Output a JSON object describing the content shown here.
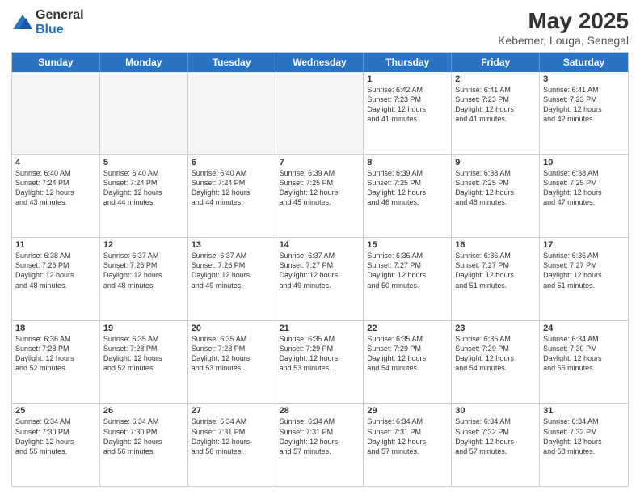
{
  "logo": {
    "general": "General",
    "blue": "Blue"
  },
  "title": {
    "month": "May 2025",
    "location": "Kebemer, Louga, Senegal"
  },
  "days": [
    "Sunday",
    "Monday",
    "Tuesday",
    "Wednesday",
    "Thursday",
    "Friday",
    "Saturday"
  ],
  "rows": [
    [
      {
        "day": "",
        "info": "",
        "empty": true
      },
      {
        "day": "",
        "info": "",
        "empty": true
      },
      {
        "day": "",
        "info": "",
        "empty": true
      },
      {
        "day": "",
        "info": "",
        "empty": true
      },
      {
        "day": "1",
        "info": "Sunrise: 6:42 AM\nSunset: 7:23 PM\nDaylight: 12 hours\nand 41 minutes."
      },
      {
        "day": "2",
        "info": "Sunrise: 6:41 AM\nSunset: 7:23 PM\nDaylight: 12 hours\nand 41 minutes."
      },
      {
        "day": "3",
        "info": "Sunrise: 6:41 AM\nSunset: 7:23 PM\nDaylight: 12 hours\nand 42 minutes."
      }
    ],
    [
      {
        "day": "4",
        "info": "Sunrise: 6:40 AM\nSunset: 7:24 PM\nDaylight: 12 hours\nand 43 minutes."
      },
      {
        "day": "5",
        "info": "Sunrise: 6:40 AM\nSunset: 7:24 PM\nDaylight: 12 hours\nand 44 minutes."
      },
      {
        "day": "6",
        "info": "Sunrise: 6:40 AM\nSunset: 7:24 PM\nDaylight: 12 hours\nand 44 minutes."
      },
      {
        "day": "7",
        "info": "Sunrise: 6:39 AM\nSunset: 7:25 PM\nDaylight: 12 hours\nand 45 minutes."
      },
      {
        "day": "8",
        "info": "Sunrise: 6:39 AM\nSunset: 7:25 PM\nDaylight: 12 hours\nand 46 minutes."
      },
      {
        "day": "9",
        "info": "Sunrise: 6:38 AM\nSunset: 7:25 PM\nDaylight: 12 hours\nand 46 minutes."
      },
      {
        "day": "10",
        "info": "Sunrise: 6:38 AM\nSunset: 7:25 PM\nDaylight: 12 hours\nand 47 minutes."
      }
    ],
    [
      {
        "day": "11",
        "info": "Sunrise: 6:38 AM\nSunset: 7:26 PM\nDaylight: 12 hours\nand 48 minutes."
      },
      {
        "day": "12",
        "info": "Sunrise: 6:37 AM\nSunset: 7:26 PM\nDaylight: 12 hours\nand 48 minutes."
      },
      {
        "day": "13",
        "info": "Sunrise: 6:37 AM\nSunset: 7:26 PM\nDaylight: 12 hours\nand 49 minutes."
      },
      {
        "day": "14",
        "info": "Sunrise: 6:37 AM\nSunset: 7:27 PM\nDaylight: 12 hours\nand 49 minutes."
      },
      {
        "day": "15",
        "info": "Sunrise: 6:36 AM\nSunset: 7:27 PM\nDaylight: 12 hours\nand 50 minutes."
      },
      {
        "day": "16",
        "info": "Sunrise: 6:36 AM\nSunset: 7:27 PM\nDaylight: 12 hours\nand 51 minutes."
      },
      {
        "day": "17",
        "info": "Sunrise: 6:36 AM\nSunset: 7:27 PM\nDaylight: 12 hours\nand 51 minutes."
      }
    ],
    [
      {
        "day": "18",
        "info": "Sunrise: 6:36 AM\nSunset: 7:28 PM\nDaylight: 12 hours\nand 52 minutes."
      },
      {
        "day": "19",
        "info": "Sunrise: 6:35 AM\nSunset: 7:28 PM\nDaylight: 12 hours\nand 52 minutes."
      },
      {
        "day": "20",
        "info": "Sunrise: 6:35 AM\nSunset: 7:28 PM\nDaylight: 12 hours\nand 53 minutes."
      },
      {
        "day": "21",
        "info": "Sunrise: 6:35 AM\nSunset: 7:29 PM\nDaylight: 12 hours\nand 53 minutes."
      },
      {
        "day": "22",
        "info": "Sunrise: 6:35 AM\nSunset: 7:29 PM\nDaylight: 12 hours\nand 54 minutes."
      },
      {
        "day": "23",
        "info": "Sunrise: 6:35 AM\nSunset: 7:29 PM\nDaylight: 12 hours\nand 54 minutes."
      },
      {
        "day": "24",
        "info": "Sunrise: 6:34 AM\nSunset: 7:30 PM\nDaylight: 12 hours\nand 55 minutes."
      }
    ],
    [
      {
        "day": "25",
        "info": "Sunrise: 6:34 AM\nSunset: 7:30 PM\nDaylight: 12 hours\nand 55 minutes."
      },
      {
        "day": "26",
        "info": "Sunrise: 6:34 AM\nSunset: 7:30 PM\nDaylight: 12 hours\nand 56 minutes."
      },
      {
        "day": "27",
        "info": "Sunrise: 6:34 AM\nSunset: 7:31 PM\nDaylight: 12 hours\nand 56 minutes."
      },
      {
        "day": "28",
        "info": "Sunrise: 6:34 AM\nSunset: 7:31 PM\nDaylight: 12 hours\nand 57 minutes."
      },
      {
        "day": "29",
        "info": "Sunrise: 6:34 AM\nSunset: 7:31 PM\nDaylight: 12 hours\nand 57 minutes."
      },
      {
        "day": "30",
        "info": "Sunrise: 6:34 AM\nSunset: 7:32 PM\nDaylight: 12 hours\nand 57 minutes."
      },
      {
        "day": "31",
        "info": "Sunrise: 6:34 AM\nSunset: 7:32 PM\nDaylight: 12 hours\nand 58 minutes."
      }
    ]
  ]
}
